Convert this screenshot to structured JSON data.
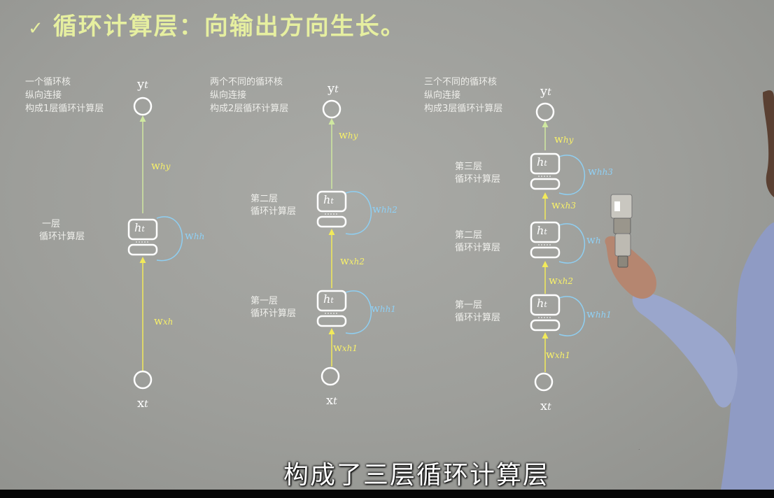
{
  "slide": {
    "check_glyph": "✓",
    "title": "循环计算层：向输出方向生长。"
  },
  "diagrams": [
    {
      "note": [
        "一个循环核",
        "纵向连接",
        "构成1层循环计算层"
      ],
      "output_label": "y",
      "output_sub": "t",
      "input_label": "x",
      "input_sub": "t",
      "why_label": "w",
      "why_sub": "hy",
      "wxh_label": "w",
      "wxh_sub": "xh",
      "cells": [
        {
          "label_line1": "一层",
          "label_line2": "循环计算层",
          "cell_text": "h",
          "cell_sub": "t",
          "whh": "w",
          "whh_sub": "hh"
        }
      ]
    },
    {
      "note": [
        "两个不同的循环核",
        "纵向连接",
        "构成2层循环计算层"
      ],
      "output_label": "y",
      "output_sub": "t",
      "input_label": "x",
      "input_sub": "t",
      "why_label": "w",
      "why_sub": "hy",
      "cells": [
        {
          "label_line1": "第二层",
          "label_line2": "循环计算层",
          "cell_text": "h",
          "cell_sub": "t",
          "whh": "w",
          "whh_sub": "hh2",
          "wxh": "w",
          "wxh_sub": "xh2"
        },
        {
          "label_line1": "第一层",
          "label_line2": "循环计算层",
          "cell_text": "h",
          "cell_sub": "t",
          "whh": "w",
          "whh_sub": "hh1",
          "wxh": "w",
          "wxh_sub": "xh1"
        }
      ]
    },
    {
      "note": [
        "三个不同的循环核",
        "纵向连接",
        "构成3层循环计算层"
      ],
      "output_label": "y",
      "output_sub": "t",
      "input_label": "x",
      "input_sub": "t",
      "why_label": "w",
      "why_sub": "hy",
      "cells": [
        {
          "label_line1": "第三层",
          "label_line2": "循环计算层",
          "cell_text": "h",
          "cell_sub": "t",
          "whh": "w",
          "whh_sub": "hh3",
          "wxh": "w",
          "wxh_sub": "xh3"
        },
        {
          "label_line1": "第二层",
          "label_line2": "循环计算层",
          "cell_text": "h",
          "cell_sub": "t",
          "whh": "w",
          "whh_sub": "h",
          "wxh": "w",
          "wxh_sub": "xh2"
        },
        {
          "label_line1": "第一层",
          "label_line2": "循环计算层",
          "cell_text": "h",
          "cell_sub": "t",
          "whh": "w",
          "whh_sub": "hh1",
          "wxh": "w",
          "wxh_sub": "xh1"
        }
      ]
    }
  ],
  "subtitle": "构成了三层循环计算层",
  "colors": {
    "yellow_arrow": "#f2ea5a",
    "green_arrow": "#cfe8a0",
    "blue_loop": "#8fcff2",
    "cell_stroke": "#ffffff",
    "title": "#e6efa0"
  }
}
